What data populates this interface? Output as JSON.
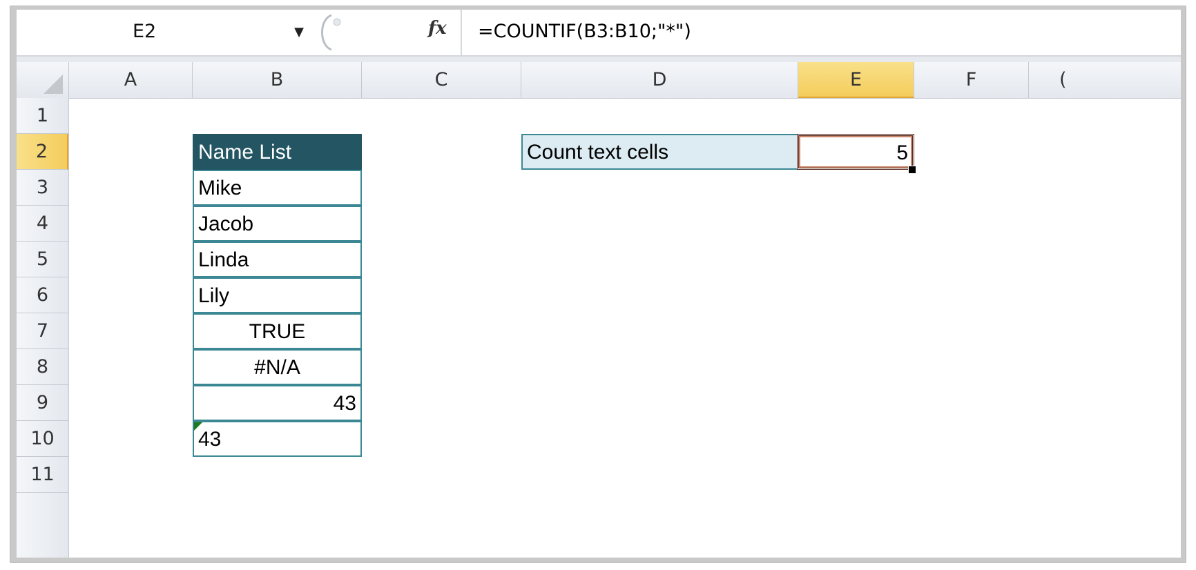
{
  "formula_bar": {
    "name_box": "E2",
    "dropdown_icon": "chevron-down-icon",
    "fx_label": "fx",
    "formula": "=COUNTIF(B3:B10;\"*\")"
  },
  "columns": [
    "A",
    "B",
    "C",
    "D",
    "E",
    "F",
    "("
  ],
  "selected_column": "E",
  "rows": [
    "1",
    "2",
    "3",
    "4",
    "5",
    "6",
    "7",
    "8",
    "9",
    "10",
    "11"
  ],
  "selected_row": "2",
  "table": {
    "header": "Name List",
    "values": [
      "Mike",
      "Jacob",
      "Linda",
      "Lily",
      "TRUE",
      "#N/A",
      "43",
      "43"
    ]
  },
  "summary": {
    "label": "Count text cells",
    "result": "5"
  },
  "colors": {
    "table_header_bg": "#235563",
    "table_border": "#3b8894",
    "label_bg": "#dcecf2",
    "selected_header": "#f4cd5c"
  }
}
